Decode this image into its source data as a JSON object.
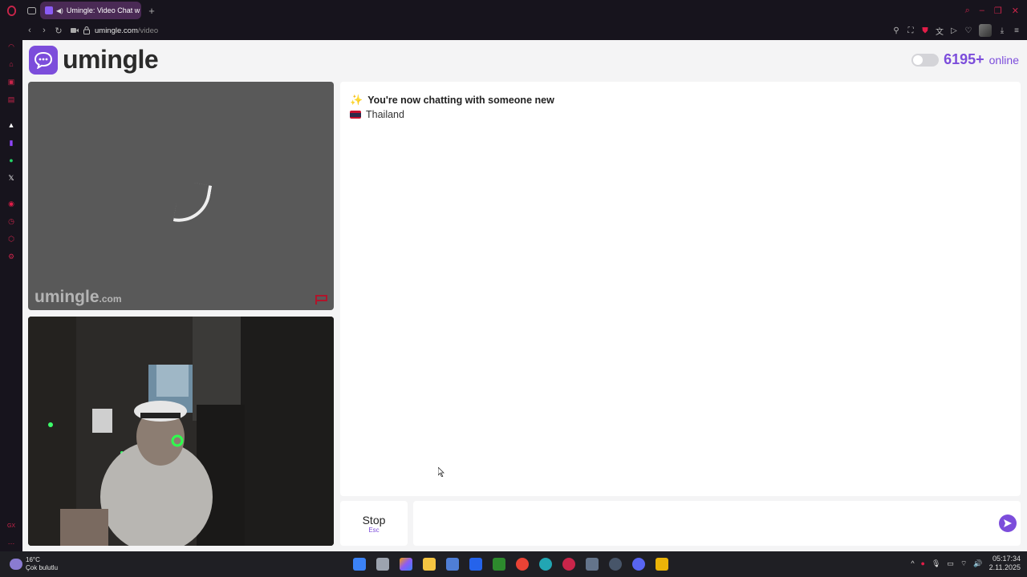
{
  "browser": {
    "tab_title": "Umingle: Video Chat w",
    "url_host": "umingle.com",
    "url_path": "/video"
  },
  "site": {
    "logo_text": "umingle",
    "online_count": "6195+",
    "online_label": "online",
    "watermark_main": "umingle",
    "watermark_suffix": ".com"
  },
  "chat": {
    "status_message": "You're now chatting with someone new",
    "country": "Thailand",
    "input_value": "",
    "stop_label": "Stop",
    "stop_shortcut": "Esc"
  },
  "taskbar": {
    "temperature": "16°C",
    "weather_desc": "Çok bulutlu",
    "time": "05:17:34",
    "date": "2.11.2025"
  },
  "colors": {
    "accent": "#7c4ddb",
    "opera_red": "#c9254a"
  }
}
